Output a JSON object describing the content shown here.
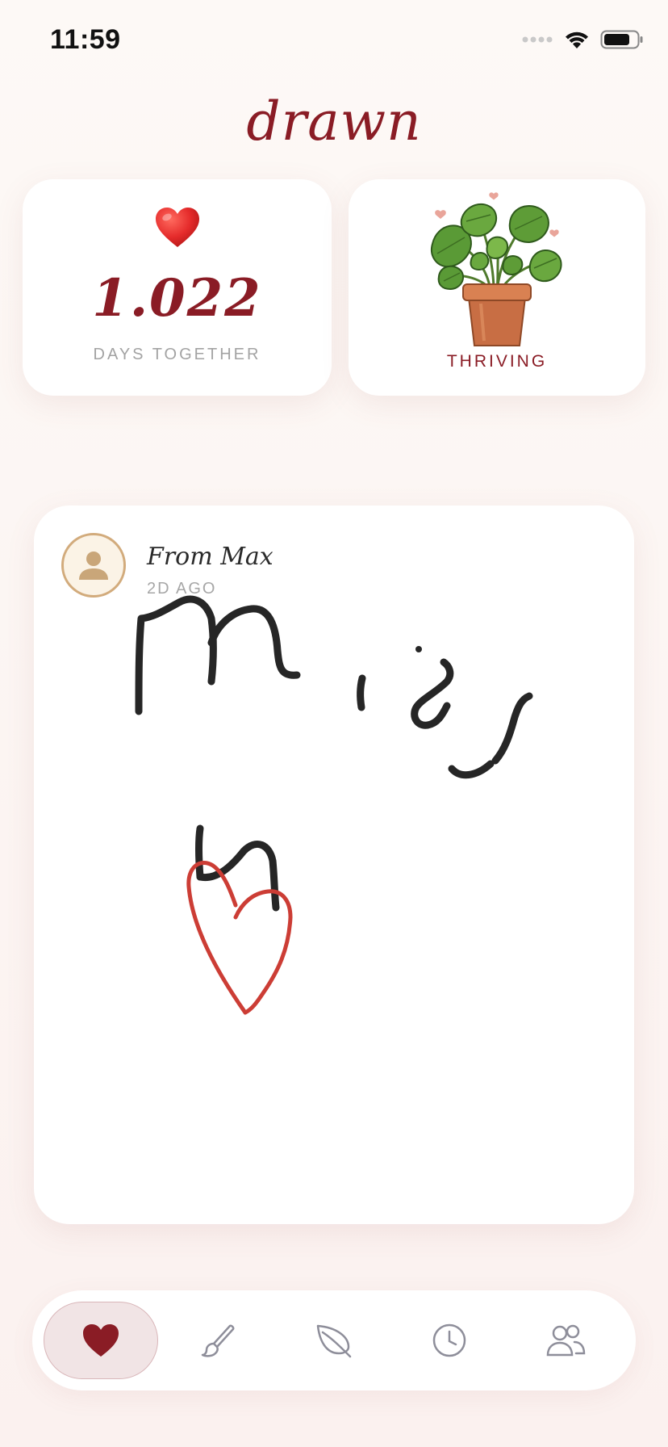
{
  "status_bar": {
    "time": "11:59"
  },
  "app": {
    "title": "drawn"
  },
  "days_card": {
    "count": "1.022",
    "label": "DAYS TOGETHER",
    "icon": "heart-emoji-icon"
  },
  "plant_card": {
    "status": "THRIVING",
    "icon": "potted-plant-icon"
  },
  "message": {
    "from": "From Max",
    "time_ago": "2D AGO",
    "drawing": "handwritten doodle",
    "stroke_colors": {
      "ink": "#262626",
      "heart": "#cc3d35"
    }
  },
  "tabs": [
    {
      "name": "home",
      "icon": "heart-icon",
      "active": true
    },
    {
      "name": "draw",
      "icon": "brush-icon",
      "active": false
    },
    {
      "name": "plant",
      "icon": "leaf-icon",
      "active": false
    },
    {
      "name": "history",
      "icon": "clock-icon",
      "active": false
    },
    {
      "name": "partner",
      "icon": "people-icon",
      "active": false
    }
  ],
  "colors": {
    "accent": "#8a1c25",
    "background": "#fdf9f6",
    "muted": "#a3a3a3",
    "avatar_ring": "#d2ab7c"
  }
}
